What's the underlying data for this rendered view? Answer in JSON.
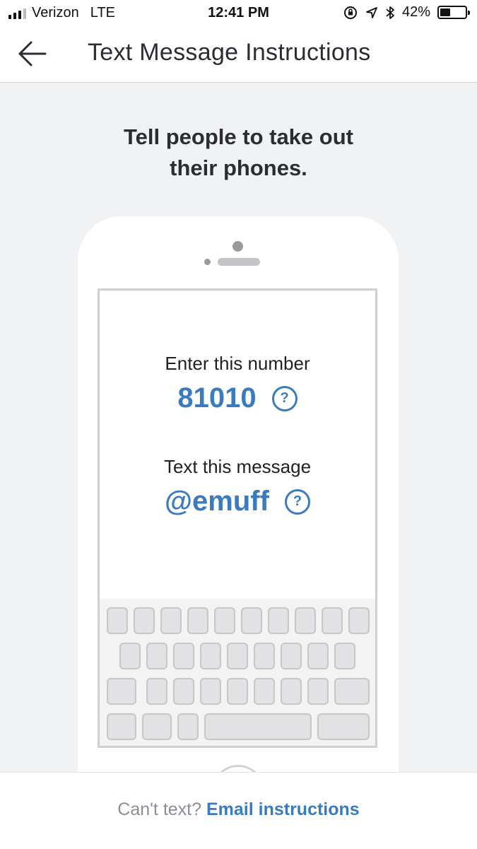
{
  "status_bar": {
    "carrier": "Verizon",
    "network": "LTE",
    "time": "12:41 PM",
    "battery_percent": "42%",
    "battery_level": 0.42,
    "icons": [
      "signal-icon",
      "rotation-lock-icon",
      "location-arrow-icon",
      "bluetooth-icon",
      "battery-icon"
    ]
  },
  "header": {
    "back_icon": "arrow-left-icon",
    "title": "Text Message Instructions"
  },
  "main": {
    "headline_line1": "Tell people to take out",
    "headline_line2": "their phones."
  },
  "phone_screen": {
    "number_label": "Enter this number",
    "number_value": "81010",
    "message_label": "Text this message",
    "message_value": "@emuff",
    "help_glyph": "?"
  },
  "footer": {
    "prompt": "Can't text?",
    "link": "Email instructions"
  },
  "colors": {
    "accent": "#3a7bc0",
    "background": "#f1f2f4",
    "text": "#2b2d33",
    "muted": "#8c8e94"
  }
}
